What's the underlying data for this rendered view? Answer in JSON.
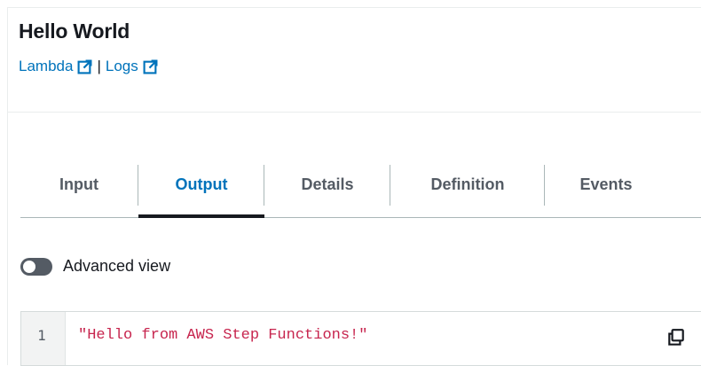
{
  "header": {
    "title": "Hello World",
    "links": [
      {
        "label": "Lambda",
        "icon": "external-link-icon"
      },
      {
        "label": "Logs",
        "icon": "external-link-icon"
      }
    ],
    "separator": "|"
  },
  "tabs": [
    {
      "label": "Input",
      "active": false
    },
    {
      "label": "Output",
      "active": true
    },
    {
      "label": "Details",
      "active": false
    },
    {
      "label": "Definition",
      "active": false
    },
    {
      "label": "Events",
      "active": false
    }
  ],
  "advanced_view": {
    "label": "Advanced view",
    "enabled": false
  },
  "output": {
    "line_number": "1",
    "code": "\"Hello from AWS Step Functions!\"",
    "copy_icon": "copy-icon"
  },
  "colors": {
    "link": "#0073bb",
    "active_tab": "#0073bb",
    "tab_indicator": "#16191f",
    "code_string": "#c7254e",
    "toggle_off": "#545b64"
  }
}
